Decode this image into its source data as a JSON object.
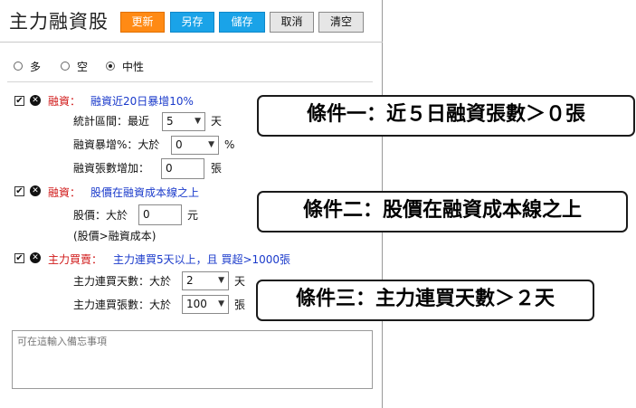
{
  "header": {
    "title": "主力融資股",
    "buttons": {
      "update": "更新",
      "save_as": "另存",
      "save": "儲存",
      "cancel": "取消",
      "clear": "清空"
    }
  },
  "direction": {
    "options": [
      "多",
      "空",
      "中性"
    ],
    "selected": "中性"
  },
  "conditions": [
    {
      "checked": true,
      "category": "融資：",
      "description": "融資近20日暴增10%",
      "fields": [
        {
          "label": "統計區間：最近",
          "value": "5",
          "unit": "天",
          "kind": "select"
        },
        {
          "label": "融資暴增%：大於",
          "value": "0",
          "unit": "%",
          "kind": "select"
        },
        {
          "label": "融資張數增加：",
          "value": "0",
          "unit": "張",
          "kind": "input"
        }
      ]
    },
    {
      "checked": true,
      "category": "融資：",
      "description": "股價在融資成本線之上",
      "fields": [
        {
          "label": "股價：大於",
          "value": "0",
          "unit": "元",
          "kind": "input"
        }
      ],
      "note": "(股價>融資成本)"
    },
    {
      "checked": true,
      "category": "主力買賣：",
      "description": "主力連買5天以上，且 買超>1000張",
      "fields": [
        {
          "label": "主力連買天數：大於",
          "value": "2",
          "unit": "天",
          "kind": "select"
        },
        {
          "label": "主力連買張數：大於",
          "value": "100",
          "unit": "張",
          "kind": "select"
        }
      ]
    }
  ],
  "memo": {
    "placeholder": "可在這輸入備忘事項"
  },
  "callouts": [
    "條件一：近５日融資張數＞０張",
    "條件二：股價在融資成本線之上",
    "條件三：主力連買天數＞２天"
  ],
  "icons": {
    "checkbox": "check-icon",
    "delete": "delete-x-icon",
    "dropdown": "chevron-down-icon"
  }
}
